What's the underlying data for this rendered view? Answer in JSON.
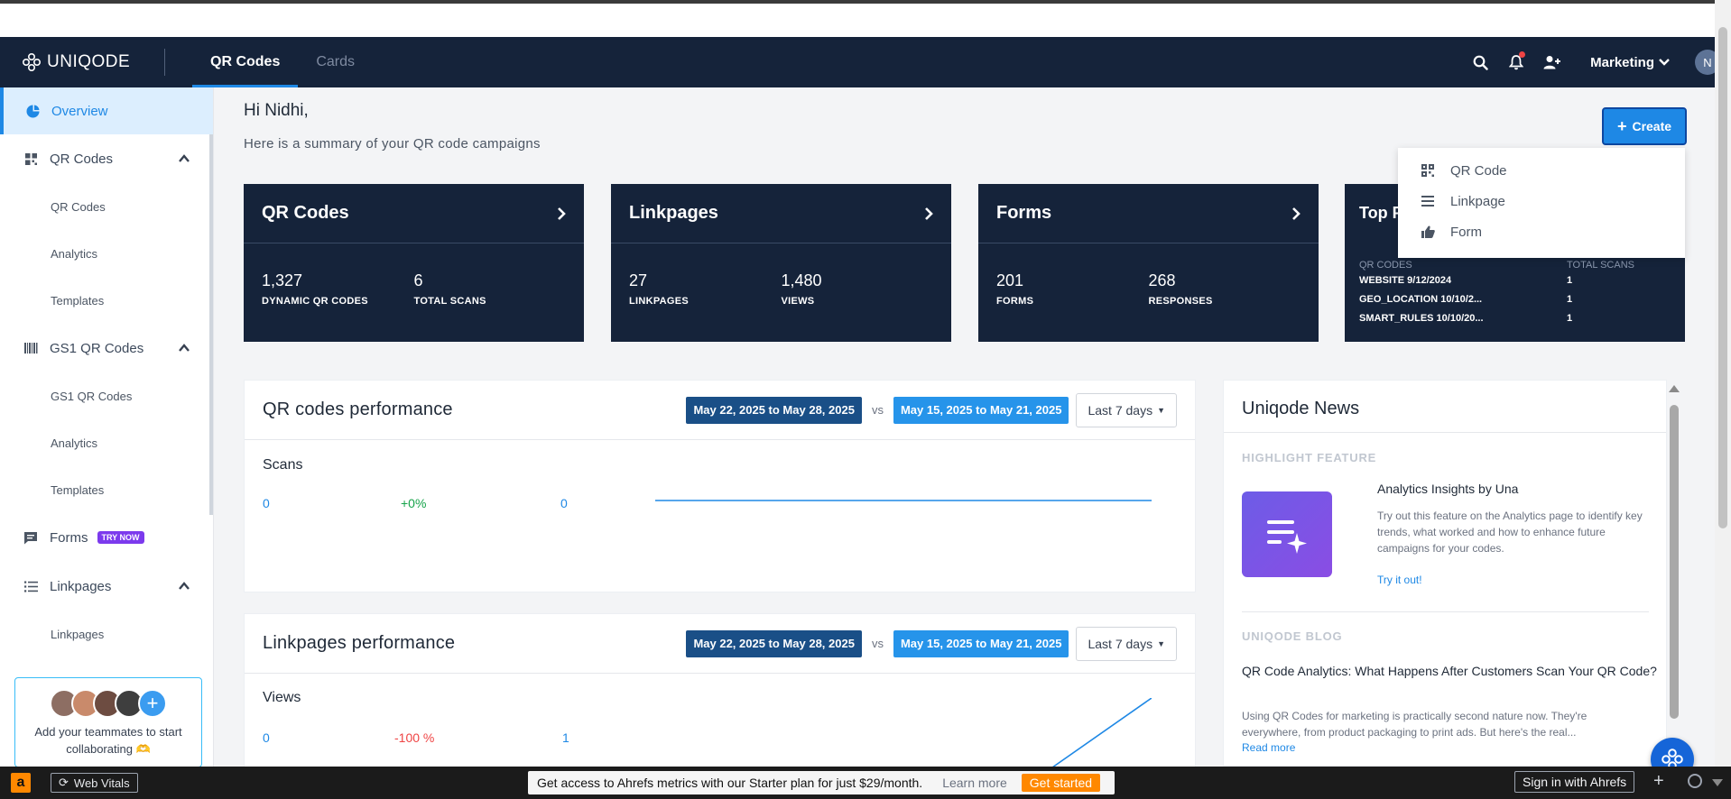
{
  "brand": {
    "name": "UNIQODE"
  },
  "topnav": {
    "tabs": [
      {
        "label": "QR Codes"
      },
      {
        "label": "Cards"
      }
    ],
    "workspace": "Marketing",
    "avatar_initial": "N"
  },
  "sidebar": {
    "items": [
      {
        "label": "Overview",
        "icon": "pie-chart-icon"
      },
      {
        "label": "QR Codes",
        "icon": "qr-grid-icon",
        "children": [
          "QR Codes",
          "Analytics",
          "Templates"
        ]
      },
      {
        "label": "GS1 QR Codes",
        "icon": "barcode-icon",
        "children": [
          "GS1 QR Codes",
          "Analytics",
          "Templates"
        ]
      },
      {
        "label": "Forms",
        "icon": "form-icon",
        "badge": "TRY NOW"
      },
      {
        "label": "Linkpages",
        "icon": "list-icon",
        "children": [
          "Linkpages"
        ]
      }
    ],
    "team": {
      "text": "Add your teammates to start collaborating 🫶"
    }
  },
  "header": {
    "greeting": "Hi Nidhi,",
    "summary": "Here is a summary of your QR code campaigns",
    "create_label": "Create"
  },
  "create_menu": [
    "QR Code",
    "Linkpage",
    "Form"
  ],
  "stats": [
    {
      "title": "QR Codes",
      "a_value": "1,327",
      "a_label": "DYNAMIC QR CODES",
      "b_value": "6",
      "b_label": "TOTAL SCANS"
    },
    {
      "title": "Linkpages",
      "a_value": "27",
      "a_label": "LINKPAGES",
      "b_value": "1,480",
      "b_label": "VIEWS"
    },
    {
      "title": "Forms",
      "a_value": "201",
      "a_label": "FORMS",
      "b_value": "268",
      "b_label": "RESPONSES"
    }
  ],
  "top_card": {
    "title": "Top P",
    "col1": "QR CODES",
    "col2": "TOTAL SCANS",
    "rows": [
      {
        "name": "WEBSITE 9/12/2024",
        "scans": "1"
      },
      {
        "name": "GEO_LOCATION 10/10/2...",
        "scans": "1"
      },
      {
        "name": "SMART_RULES 10/10/20...",
        "scans": "1"
      }
    ]
  },
  "qr_perf": {
    "title": "QR codes performance",
    "current_range": "May 22, 2025 to May 28, 2025",
    "vs": "vs",
    "previous_range": "May 15, 2025 to May 21, 2025",
    "period": "Last 7 days",
    "metric": "Scans",
    "current": "0",
    "change": "+0%",
    "previous": "0",
    "trend": [
      0,
      0
    ]
  },
  "lp_perf": {
    "title": "Linkpages performance",
    "current_range": "May 22, 2025 to May 28, 2025",
    "vs": "vs",
    "previous_range": "May 15, 2025 to May 21, 2025",
    "period": "Last 7 days",
    "metric": "Views",
    "current": "0",
    "change": "-100 %",
    "previous": "1",
    "trend": [
      0,
      1
    ]
  },
  "news": {
    "title": "Uniqode News",
    "highlight_label": "HIGHLIGHT FEATURE",
    "feature_title": "Analytics Insights by Una",
    "feature_desc": "Try out this feature on the Analytics page to identify key trends, what worked and how to enhance future campaigns for your codes.",
    "feature_link": "Try it out!",
    "blog_label": "UNIQODE BLOG",
    "blog_title": "QR Code Analytics: What Happens After Customers Scan Your QR Code?",
    "blog_desc": "Using QR Codes for marketing is practically second nature now. They're everywhere, from product packaging to print ads. But here's the real...",
    "blog_link": "Read more"
  },
  "ahrefs": {
    "logo": "a",
    "web_vitals": "Web Vitals",
    "promo": "Get access to Ahrefs metrics with our Starter plan for just $29/month.",
    "learn_more": "Learn more",
    "get_started": "Get started",
    "sign_in": "Sign in with Ahrefs"
  },
  "colors": {
    "navy": "#15233a",
    "accent": "#1e88e5",
    "positive": "#16a34a",
    "negative": "#ef4444"
  }
}
